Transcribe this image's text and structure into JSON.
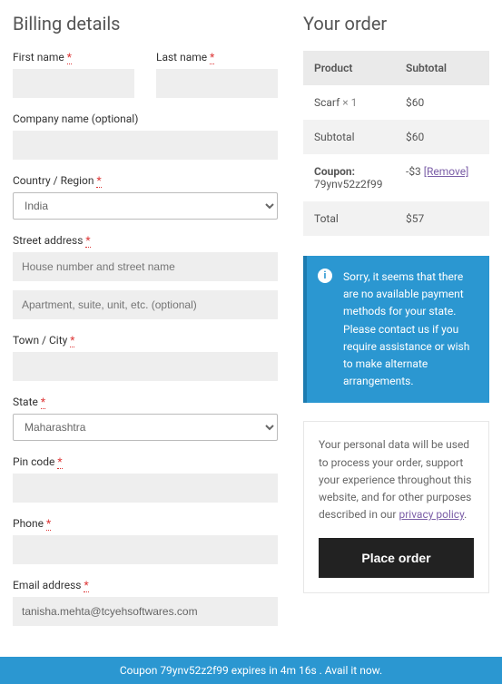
{
  "billing": {
    "heading": "Billing details",
    "first_name_label": "First name",
    "last_name_label": "Last name",
    "company_label": "Company name (optional)",
    "country_label": "Country / Region",
    "country_value": "India",
    "street_label": "Street address",
    "street_placeholder": "House number and street name",
    "street2_placeholder": "Apartment, suite, unit, etc. (optional)",
    "city_label": "Town / City",
    "state_label": "State",
    "state_value": "Maharashtra",
    "pin_label": "Pin code",
    "phone_label": "Phone",
    "email_label": "Email address",
    "email_value": "tanisha.mehta@tcyehsoftwares.com"
  },
  "order": {
    "heading": "Your order",
    "product_header": "Product",
    "subtotal_header": "Subtotal",
    "item_name": "Scarf",
    "item_qty": "× 1",
    "item_price": "$60",
    "subtotal_label": "Subtotal",
    "subtotal_value": "$60",
    "coupon_label": "Coupon:",
    "coupon_code": "79ynv52z2f99",
    "coupon_discount": "-$3",
    "remove_label": "[Remove]",
    "total_label": "Total",
    "total_value": "$57"
  },
  "notice": {
    "text": "Sorry, it seems that there are no available payment methods for your state. Please contact us if you require assistance or wish to make alternate arrangements."
  },
  "privacy": {
    "text_before": "Your personal data will be used to process your order, support your experience throughout this website, and for other purposes described in our ",
    "link": "privacy policy",
    "text_after": "."
  },
  "place_order": "Place order",
  "coupon_bar": {
    "text": "Coupon 79ynv52z2f99 expires in 4m 16s . Avail it now."
  },
  "required_mark": "*"
}
